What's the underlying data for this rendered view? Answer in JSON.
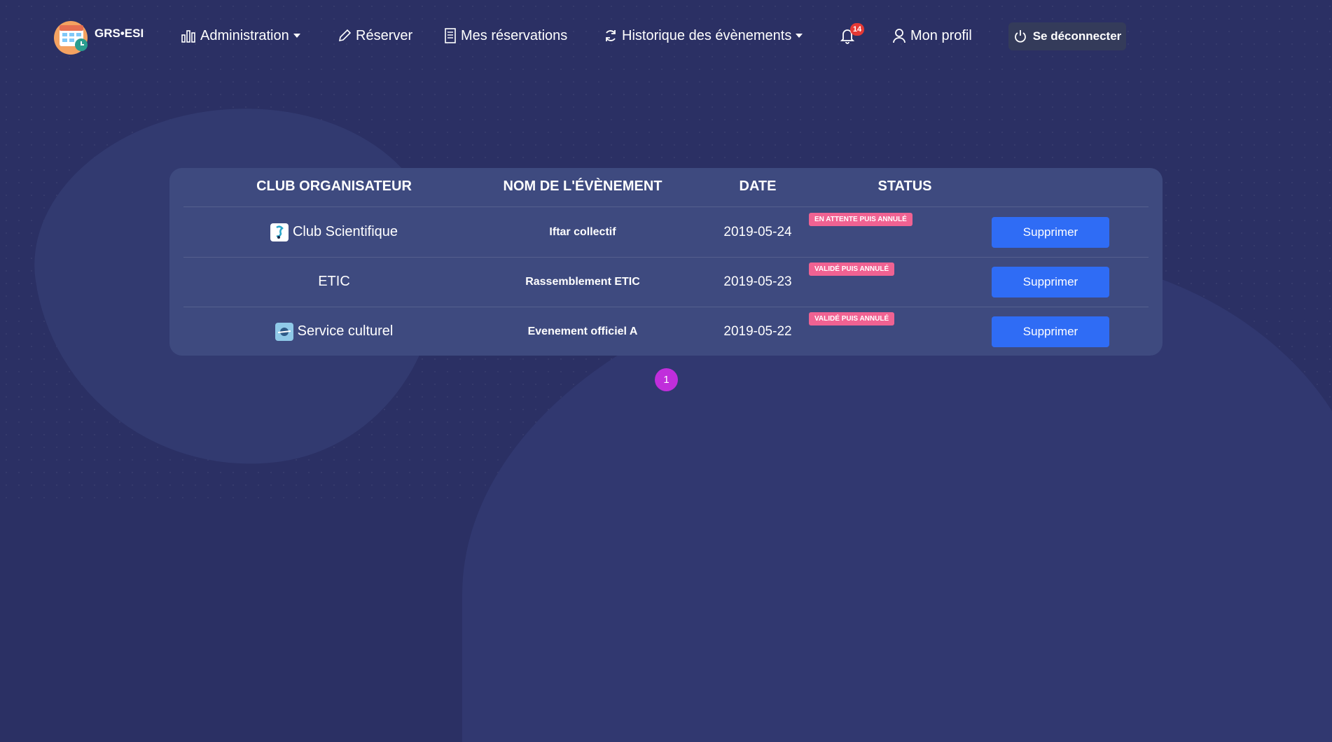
{
  "brand": {
    "name": "GRS•ESI"
  },
  "nav": {
    "administration": "Administration",
    "reserver": "Réserver",
    "mes_reservations": "Mes réservations",
    "historique": "Historique des évènements",
    "notifications_count": "14",
    "profil": "Mon profil",
    "logout": "Se déconnecter"
  },
  "table": {
    "headers": [
      "CLUB ORGANISATEUR",
      "NOM DE L'ÉVÈNEMENT",
      "DATE",
      "STATUS"
    ],
    "rows": [
      {
        "club": "Club Scientifique",
        "club_icon": "club-scientifique-logo",
        "event": "Iftar collectif",
        "date": "2019-05-24",
        "status": "EN ATTENTE PUIS ANNULÉ",
        "action": "Supprimer"
      },
      {
        "club": "ETIC",
        "club_icon": "",
        "event": "Rassemblement ETIC",
        "date": "2019-05-23",
        "status": "VALIDÉ PUIS ANNULÉ",
        "action": "Supprimer"
      },
      {
        "club": "Service culturel",
        "club_icon": "service-culturel-logo",
        "event": "Evenement officiel A",
        "date": "2019-05-22",
        "status": "VALIDÉ PUIS ANNULÉ",
        "action": "Supprimer"
      }
    ]
  },
  "pagination": {
    "current": "1"
  },
  "colors": {
    "background": "#2b3064",
    "card": "#3e4a7f",
    "button": "#2f6cf5",
    "status_badge": "#f06292",
    "pagination": "#c02edb",
    "notification_badge": "#e53935"
  }
}
